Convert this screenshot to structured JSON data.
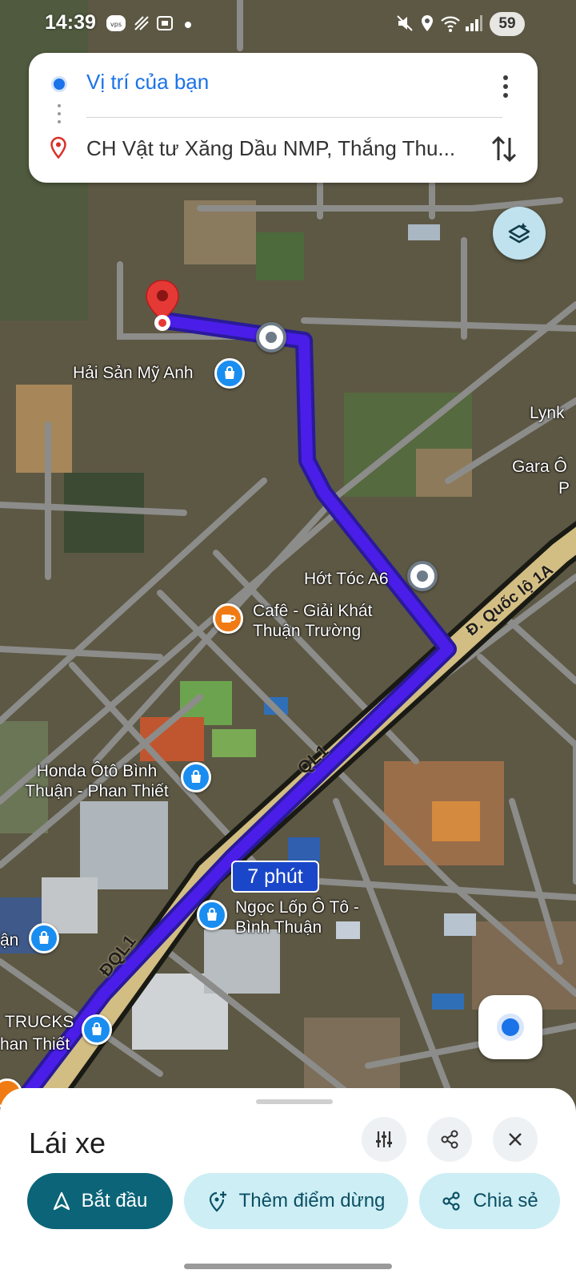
{
  "status_bar": {
    "time": "14:39",
    "battery": "59"
  },
  "route": {
    "origin": "Vị trí của bạn",
    "destination": "CH Vật tư Xăng Dầu NMP, Thắng Thu..."
  },
  "map": {
    "road_labels": {
      "ql1": "QL1",
      "dql1": "ĐQL1",
      "quoc_lo_1a": "Đ. Quốc lộ 1A"
    },
    "places": {
      "hai_san": "Hải Sản Mỹ Anh",
      "lynk": "Lynk",
      "gara": "Gara Ô",
      "gara_2": "P",
      "hot_toc": "Hớt Tóc A6",
      "cafe": "Cafê - Giải Khát Thuận Trường",
      "honda": "Honda Ôtô Bình Thuận - Phan Thiết",
      "ngoc_lop": "Ngọc Lốp Ô Tô - Bình Thuận",
      "edge_left": "ận",
      "trucks": "TRUCKS",
      "trucks_2": "han Thiết"
    },
    "duration_badge": "7 phút",
    "colors": {
      "route": "#4a1ee8",
      "road_major": "#d2bd83",
      "badge": "#1a47c9"
    }
  },
  "bottom_sheet": {
    "mode": "Lái xe",
    "start_label": "Bắt đầu",
    "add_stop_label": "Thêm điểm dừng",
    "share_label": "Chia sẻ",
    "icons": [
      "options-icon",
      "share-icon",
      "close-icon"
    ]
  }
}
